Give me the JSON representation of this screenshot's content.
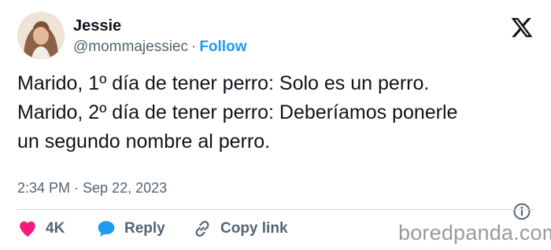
{
  "tweet": {
    "author_name": "Jessie",
    "handle": "@mommajessiec",
    "separator": "·",
    "follow_label": "Follow",
    "text_lines": [
      "Marido, 1º día de tener perro: Solo es un perro.",
      "Marido, 2º día de tener perro: Deberíamos ponerle",
      "un segundo nombre al perro."
    ],
    "timestamp": "2:34 PM · Sep 22, 2023"
  },
  "actions": {
    "like_count": "4K",
    "reply_label": "Reply",
    "copy_link_label": "Copy link"
  },
  "icons": {
    "logo": "x-logo-icon",
    "info": "info-icon",
    "like": "heart-icon",
    "reply": "speech-bubble-icon",
    "copy_link": "link-icon"
  },
  "colors": {
    "text": "#0f1419",
    "secondary": "#536471",
    "follow": "#1d9bf0",
    "like": "#f91880",
    "reply": "#1d9bf0",
    "divider": "#cfd9de"
  },
  "watermark": "boredpanda.com"
}
